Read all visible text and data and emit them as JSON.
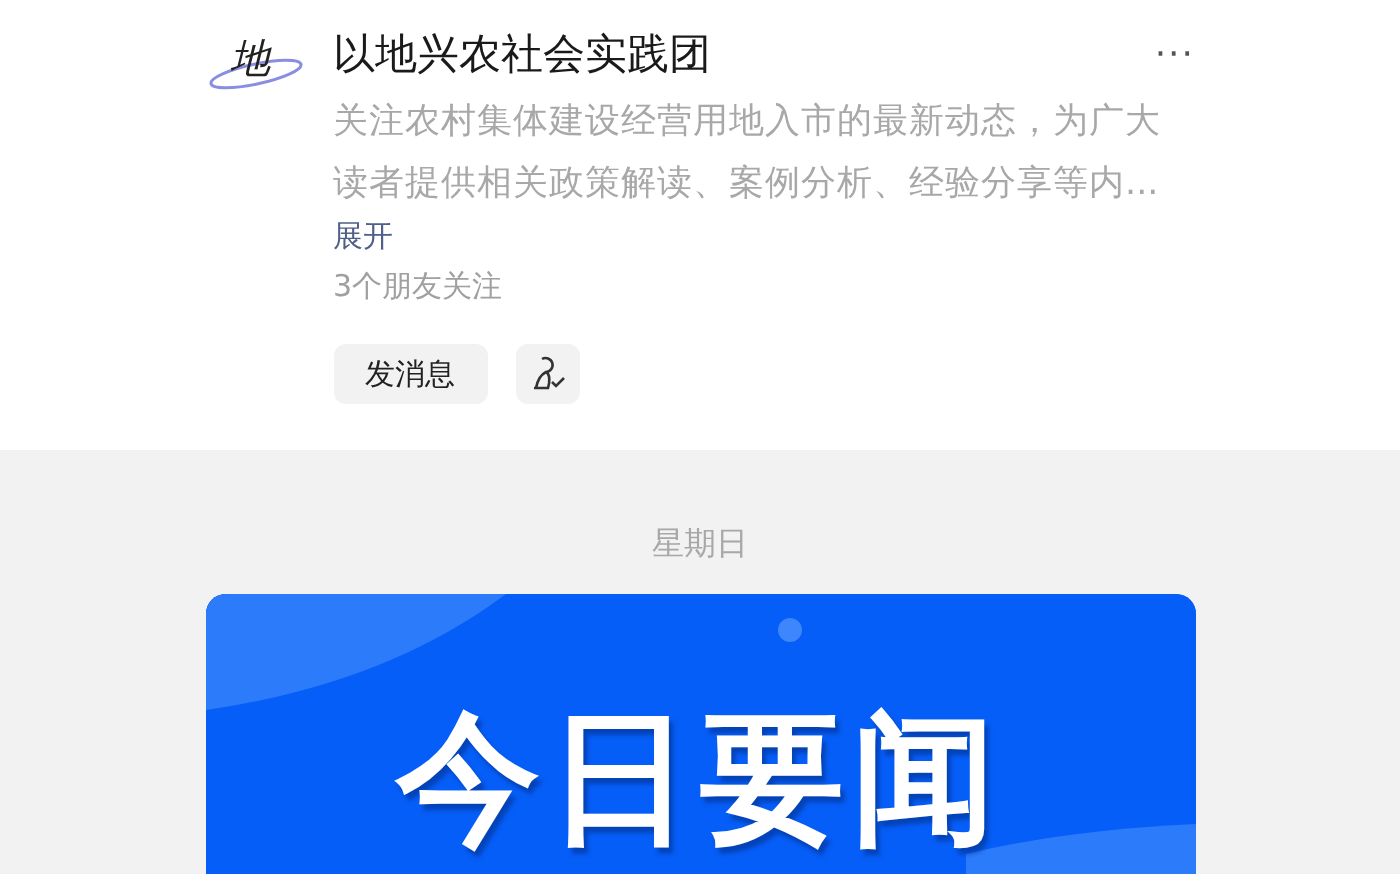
{
  "account": {
    "logo_text": "地",
    "name": "以地兴农社会实践团",
    "more": "···",
    "description_lines": [
      "关注农村集体建设经营用地入市的最新动态，为广大",
      "读者提供相关政策解读、案例分析、经验分享等内..."
    ],
    "expand": "展开",
    "friends": "3个朋友关注",
    "message_button": "发消息"
  },
  "feed": {
    "day": "星期日",
    "cover_title": "今日要闻"
  }
}
